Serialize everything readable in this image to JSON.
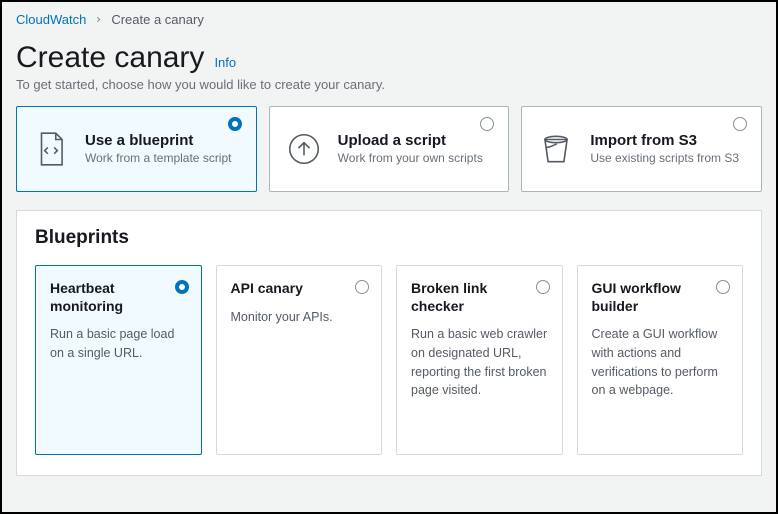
{
  "breadcrumbs": {
    "root": "CloudWatch",
    "current": "Create a canary"
  },
  "header": {
    "title": "Create canary",
    "info_label": "Info",
    "subtitle": "To get started, choose how you would like to create your canary."
  },
  "methods": [
    {
      "id": "blueprint",
      "title": "Use a blueprint",
      "desc": "Work from a template script",
      "selected": true
    },
    {
      "id": "upload",
      "title": "Upload a script",
      "desc": "Work from your own scripts",
      "selected": false
    },
    {
      "id": "s3",
      "title": "Import from S3",
      "desc": "Use existing scripts from S3",
      "selected": false
    }
  ],
  "blueprints": {
    "heading": "Blueprints",
    "items": [
      {
        "id": "heartbeat",
        "title": "Heartbeat monitoring",
        "desc": "Run a basic page load on a single URL.",
        "selected": true
      },
      {
        "id": "api",
        "title": "API canary",
        "desc": "Monitor your APIs.",
        "selected": false
      },
      {
        "id": "broken-link",
        "title": "Broken link checker",
        "desc": "Run a basic web crawler on designated URL, reporting the first broken page visited.",
        "selected": false
      },
      {
        "id": "gui-workflow",
        "title": "GUI workflow builder",
        "desc": "Create a GUI workflow with actions and verifications to perform on a webpage.",
        "selected": false
      }
    ]
  },
  "colors": {
    "accent": "#0073bb",
    "selected_fill": "#f1faff",
    "text_muted": "#687078"
  }
}
